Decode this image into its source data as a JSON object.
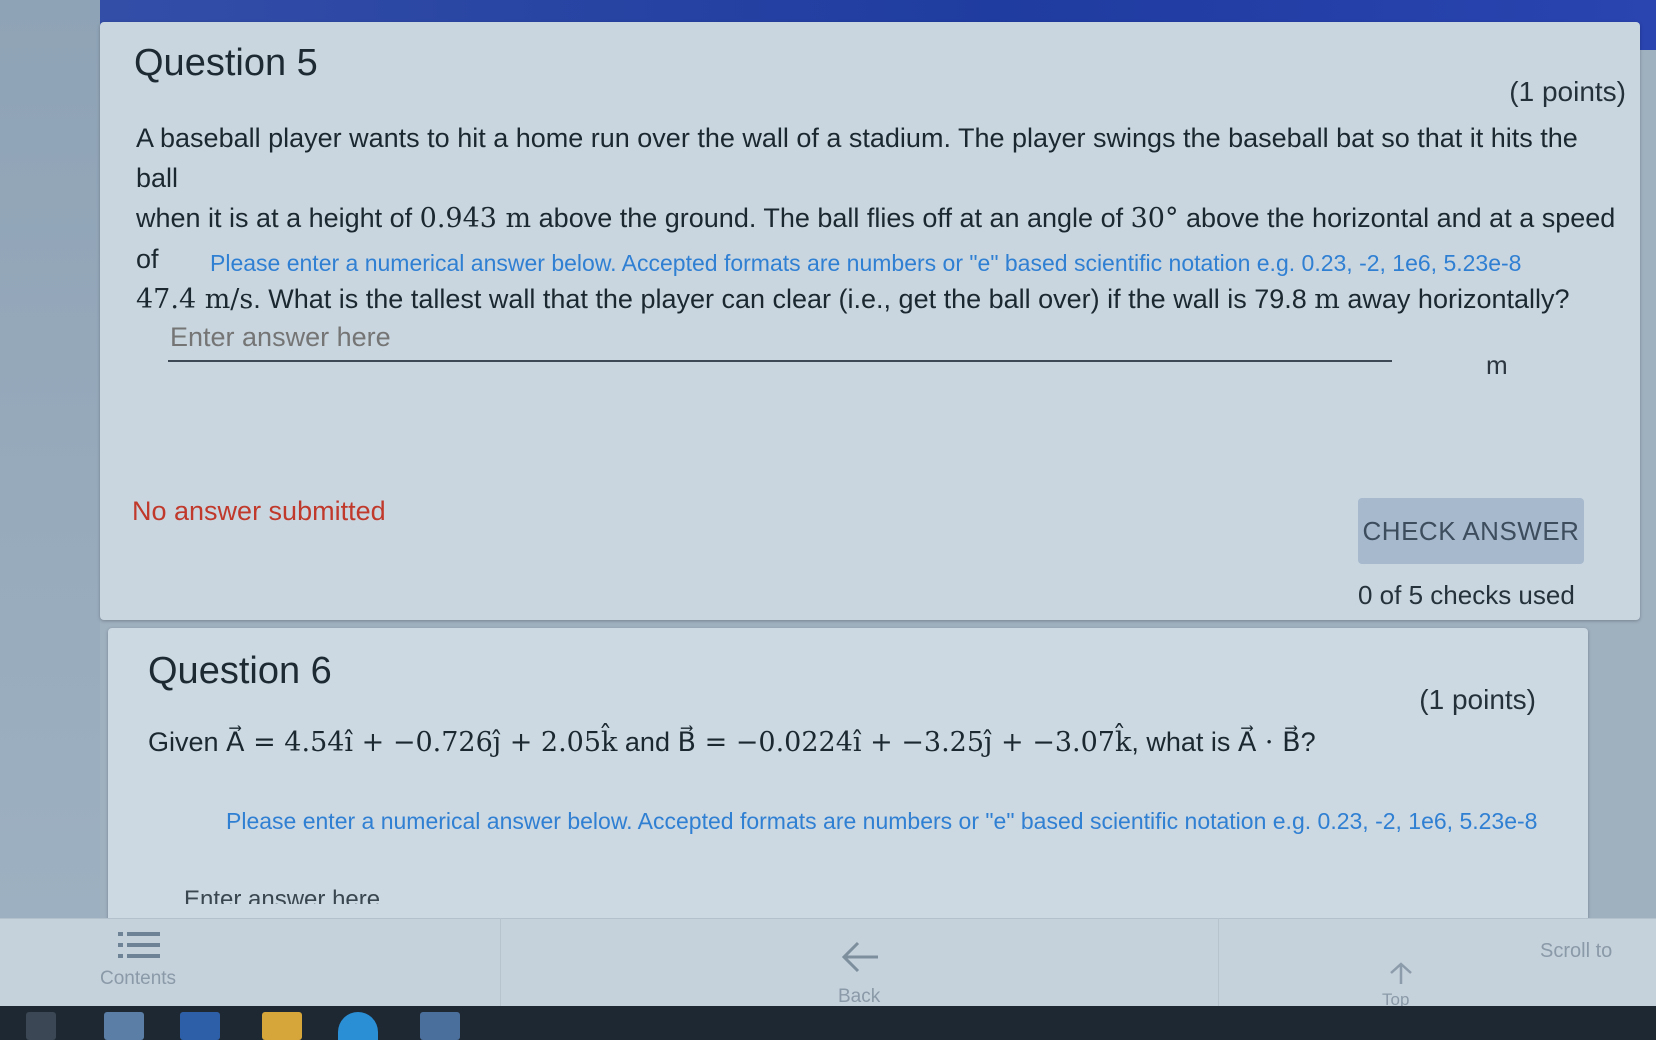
{
  "q5": {
    "title": "Question 5",
    "points": "(1 points)",
    "body_line1": "A baseball player wants to hit a home run over the wall of a stadium. The player swings the baseball bat so that it hits the ball",
    "body_line2_a": "when it is at a height of ",
    "body_line2_h": "0.943 m",
    "body_line2_b": " above the ground.  The ball flies off at an angle of ",
    "body_line2_angle": "30°",
    "body_line2_c": " above the horizontal and at a speed of",
    "body_line3_v": "47.4 m/s",
    "body_line3_a": ". What is the tallest wall that the player can clear (i.e., get the ball over) if the wall is 79.8 ",
    "body_line3_m": "m",
    "body_line3_b": " away horizontally?",
    "hint": "Please enter a numerical answer below. Accepted formats are numbers or \"e\" based scientific notation e.g. 0.23, -2, 1e6, 5.23e-8",
    "answer_placeholder": "Enter answer here",
    "answer_value": "",
    "unit": "m",
    "status": "No answer submitted",
    "check_label": "CHECK ANSWER",
    "checks_used": "0 of 5 checks used"
  },
  "q6": {
    "title": "Question 6",
    "points": "(1 points)",
    "given_label": "Given ",
    "vec_a_expr": "A⃗ = 4.54î + −0.726ĵ + 2.05k̂",
    "and_label": " and ",
    "vec_b_expr": "B⃗ = −0.0224î + −3.25ĵ + −3.07k̂",
    "question_label": ", what is ",
    "dot_expr": "A⃗ · B⃗",
    "question_mark": "?",
    "hint": "Please enter a numerical answer below. Accepted formats are numbers or \"e\" based scientific notation e.g. 0.23, -2, 1e6, 5.23e-8",
    "answer_placeholder": "Enter answer here"
  },
  "nav": {
    "contents": "Contents",
    "back": "Back",
    "top": "Top",
    "scroll_to": "Scroll to"
  },
  "colors": {
    "hint_blue": "#2f7fd3",
    "status_red": "#c0392b",
    "button_bg": "#a6b9cd"
  }
}
